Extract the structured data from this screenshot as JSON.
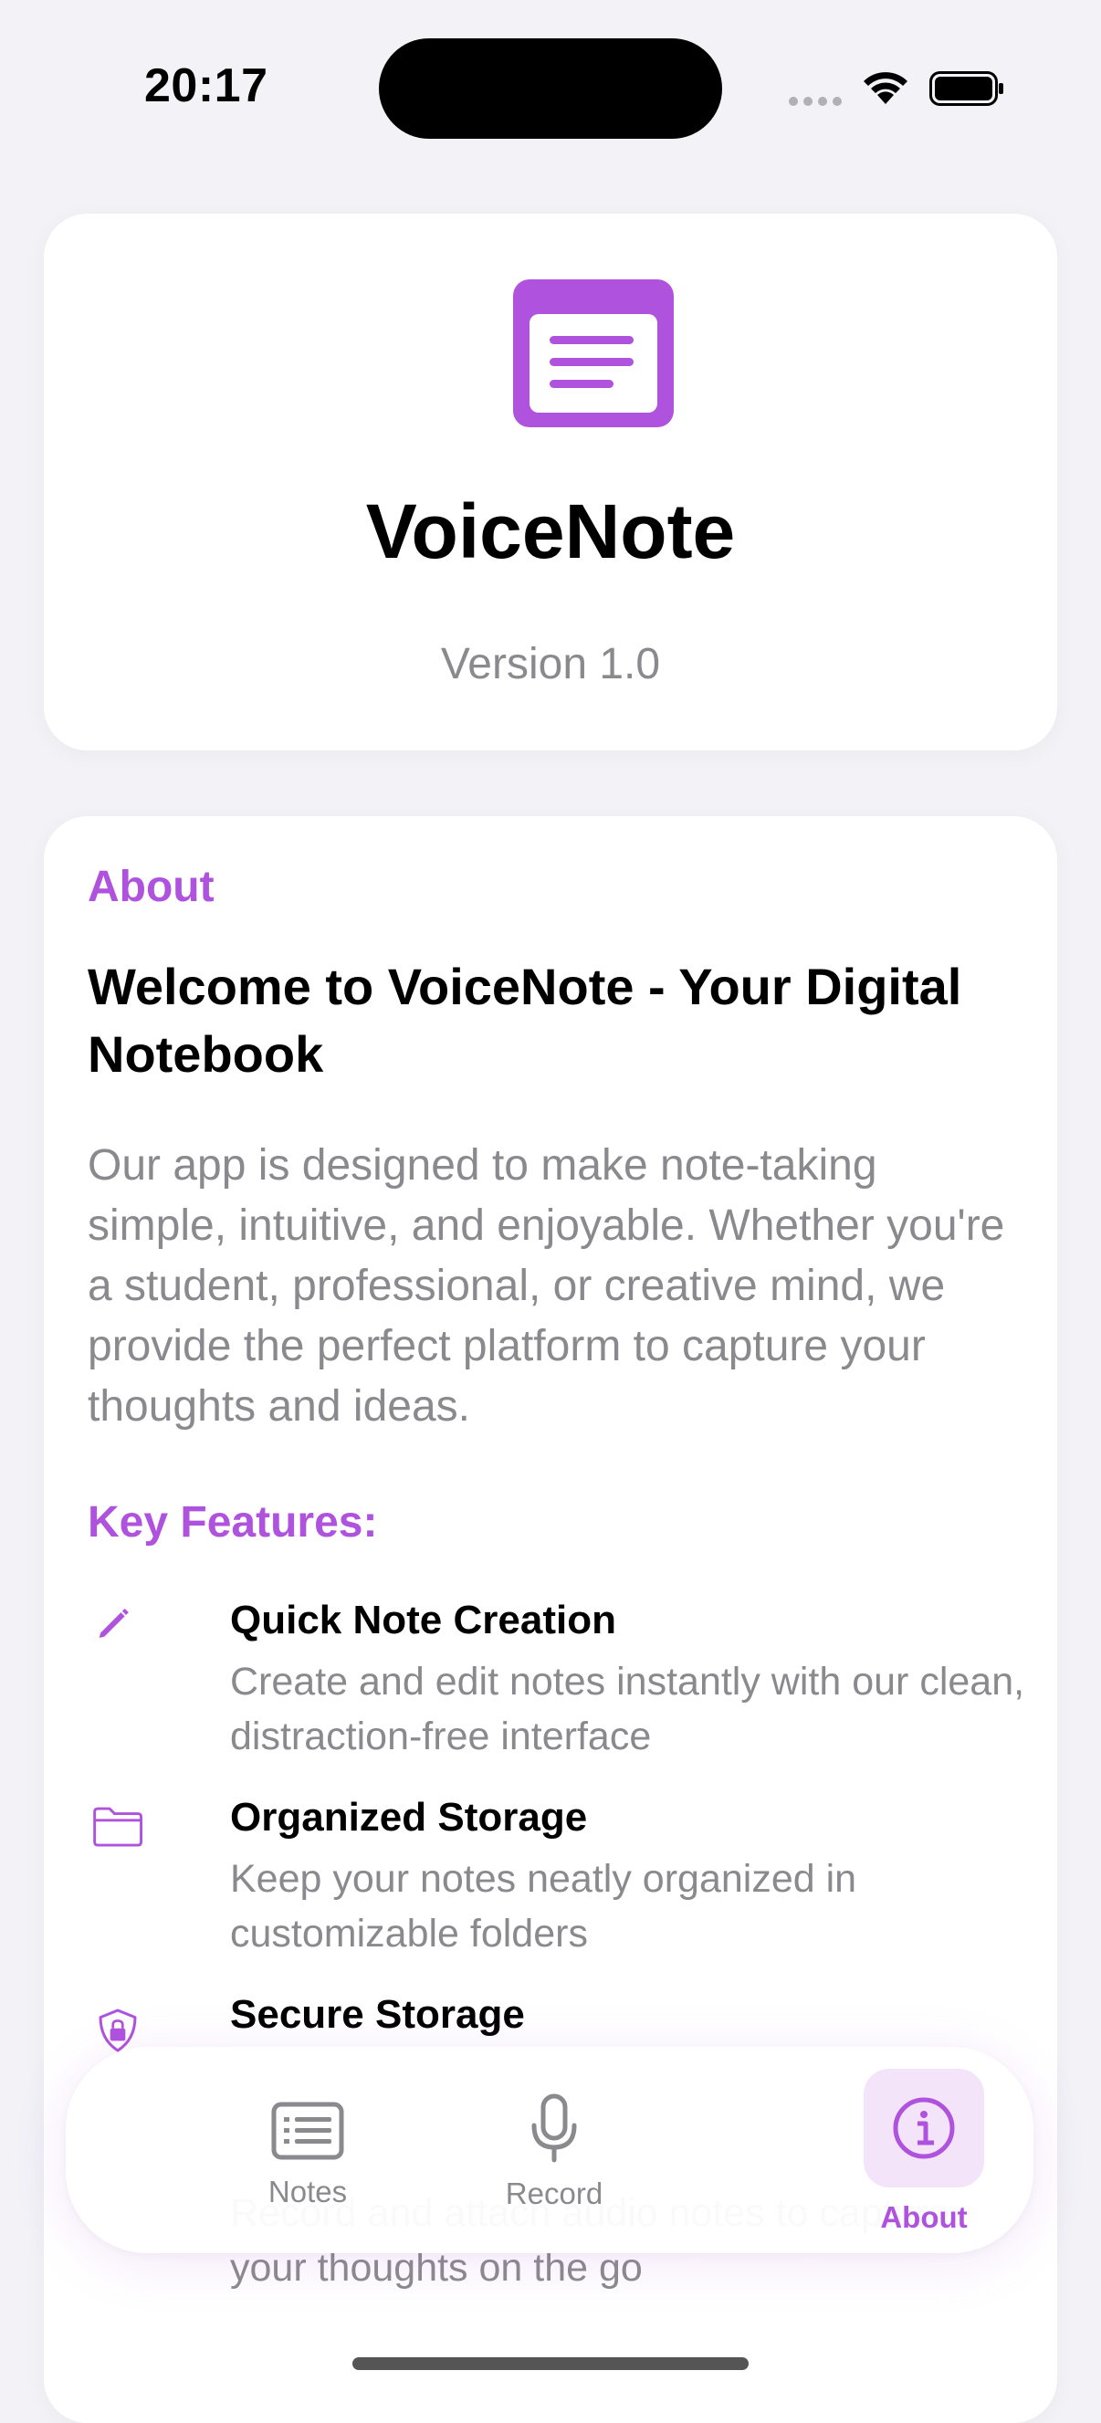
{
  "status_bar": {
    "time": "20:17"
  },
  "header": {
    "app_name": "VoiceNote",
    "version": "Version 1.0",
    "icon": "notes-app-icon"
  },
  "about": {
    "section_label": "About",
    "title": "Welcome to VoiceNote - Your Digital Notebook",
    "body": "Our app is designed to make note-taking simple, intuitive, and enjoyable. Whether you're a student, professional, or creative mind, we provide the perfect platform to capture your thoughts and ideas.",
    "features_title": "Key Features:",
    "features": [
      {
        "icon": "pencil-icon",
        "title": "Quick Note Creation",
        "description": "Create and edit notes instantly with our clean, distraction-free interface"
      },
      {
        "icon": "folder-icon",
        "title": "Organized Storage",
        "description": "Keep your notes neatly organized in customizable folders"
      },
      {
        "icon": "lock-shield-icon",
        "title": "Secure Storage",
        "description": ""
      },
      {
        "icon": "",
        "title": "",
        "description": "Record and attach audio notes to capture your thoughts on the go"
      }
    ]
  },
  "tab_bar": {
    "tabs": [
      {
        "label": "Notes",
        "icon": "notes-list-icon",
        "selected": false
      },
      {
        "label": "Record",
        "icon": "microphone-icon",
        "selected": false
      },
      {
        "label": "About",
        "icon": "info-icon",
        "selected": true
      }
    ]
  },
  "colors": {
    "accent": "#AF52DE",
    "background": "#F2F2F7",
    "secondary_text": "#8A8A8E"
  }
}
